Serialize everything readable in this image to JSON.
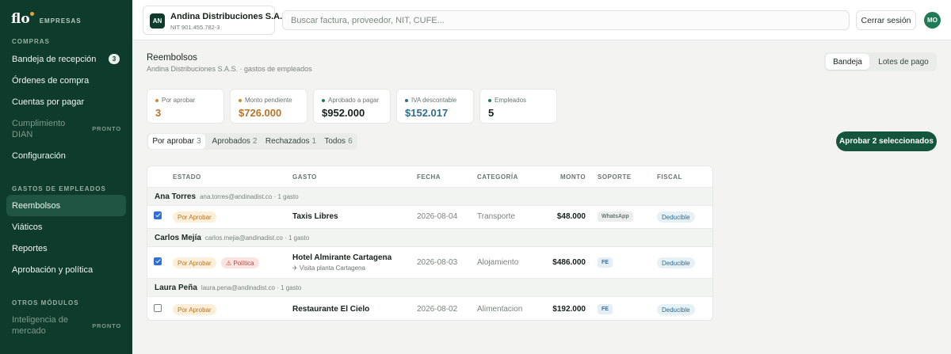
{
  "brand": {
    "logo": "flo",
    "section": "EMPRESAS"
  },
  "sidebar": {
    "compras_label": "COMPRAS",
    "compras": [
      {
        "label": "Bandeja de recepción",
        "badge": "3"
      },
      {
        "label": "Órdenes de compra"
      },
      {
        "label": "Cuentas por pagar"
      },
      {
        "label": "Cumplimiento DIAN",
        "tag": "PRONTO"
      },
      {
        "label": "Configuración"
      }
    ],
    "gastos_label": "GASTOS DE EMPLEADOS",
    "gastos": [
      {
        "label": "Reembolsos"
      },
      {
        "label": "Viáticos"
      },
      {
        "label": "Reportes"
      },
      {
        "label": "Aprobación y política"
      }
    ],
    "otros_label": "OTROS MÓDULOS",
    "otros": [
      {
        "label": "Inteligencia de mercado",
        "tag": "PRONTO"
      }
    ]
  },
  "topbar": {
    "company_initials": "AN",
    "company_name": "Andina Distribuciones S.A.S.",
    "company_nit": "NIT 901.455.782-3",
    "search_placeholder": "Buscar factura, proveedor, NIT, CUFE...",
    "logout_label": "Cerrar sesión",
    "user_initials": "MO"
  },
  "header": {
    "title": "Reembolsos",
    "subtitle": "Andina Distribuciones S.A.S. · gastos de empleados",
    "views": [
      "Bandeja",
      "Lotes de pago"
    ]
  },
  "stats": [
    {
      "label": "Por aprobar",
      "value": "3",
      "color": "#b5742a"
    },
    {
      "label": "Monto pendiente",
      "value": "$726.000",
      "color": "#b5742a"
    },
    {
      "label": "Aprobado a pagar",
      "value": "$952.000",
      "color": "#16201b"
    },
    {
      "label": "IVA descontable",
      "value": "$152.017",
      "color": "#2f6b8a"
    },
    {
      "label": "Empleados",
      "value": "5",
      "color": "#16201b"
    }
  ],
  "stat_dot_colors": [
    "#c98a3a",
    "#c98a3a",
    "#1f7a55",
    "#2f6b8a",
    "#1f7a55"
  ],
  "tabs": [
    {
      "label": "Por aprobar",
      "count": "3"
    },
    {
      "label": "Aprobados",
      "count": "2"
    },
    {
      "label": "Rechazados",
      "count": "1"
    },
    {
      "label": "Todos",
      "count": "6"
    }
  ],
  "approve_button": "Aprobar 2 seleccionados",
  "table": {
    "headers": {
      "estado": "ESTADO",
      "gasto": "GASTO",
      "fecha": "FECHA",
      "categoria": "CATEGORÍA",
      "monto": "MONTO",
      "soporte": "SOPORTE",
      "fiscal": "FISCAL"
    },
    "groups": [
      {
        "name": "Ana Torres",
        "meta": "ana.torres@andinadist.co · 1 gasto",
        "row": {
          "status": "Por Aprobar",
          "gasto": "Taxis Libres",
          "fecha": "2026-08-04",
          "categoria": "Transporte",
          "monto": "$48.000",
          "soporte": "WhatsApp",
          "fiscal": "Deducible"
        }
      },
      {
        "name": "Carlos Mejía",
        "meta": "carlos.mejia@andinadist.co · 1 gasto",
        "row": {
          "status": "Por Aprobar",
          "policy": "⚠ Política",
          "gasto": "Hotel Almirante Cartagena",
          "gasto_sub": "✈ Visita planta Cartagena",
          "fecha": "2026-08-03",
          "categoria": "Alojamiento",
          "monto": "$486.000",
          "soporte": "FE",
          "fiscal": "Deducible"
        }
      },
      {
        "name": "Laura Peña",
        "meta": "laura.pena@andinadist.co · 1 gasto",
        "row": {
          "status": "Por Aprobar",
          "gasto": "Restaurante El Cielo",
          "fecha": "2026-08-02",
          "categoria": "Alimentacion",
          "monto": "$192.000",
          "soporte": "FE",
          "fiscal": "Deducible"
        }
      }
    ]
  }
}
